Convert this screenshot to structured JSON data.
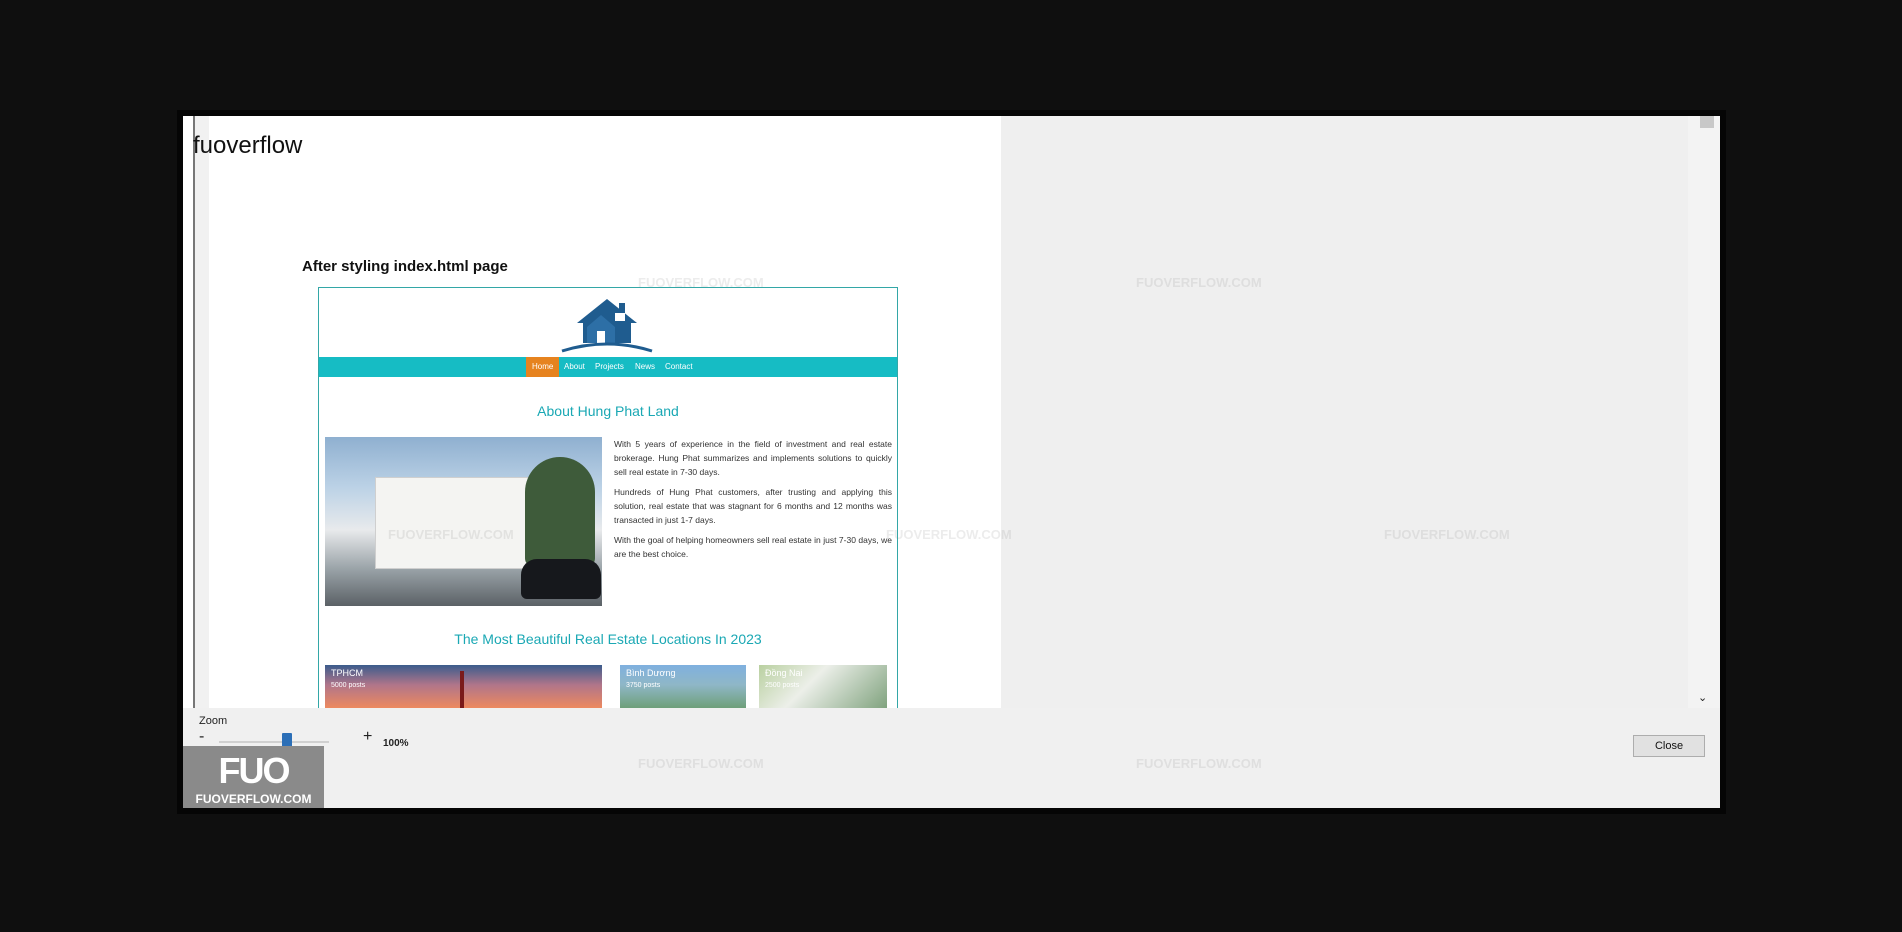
{
  "site_title": "fuoverflow",
  "caption": "After styling index.html page",
  "preview": {
    "nav": [
      "Home",
      "About",
      "Projects",
      "News",
      "Contact"
    ],
    "about_heading": "About Hung Phat Land",
    "paragraphs": [
      "With 5 years of experience in the field of investment and real estate brokerage. Hung Phat summarizes and implements solutions to quickly sell real estate in 7-30 days.",
      "Hundreds of Hung Phat customers, after trusting and applying this solution, real estate that was stagnant for 6 months and 12 months was transacted in just 1-7 days.",
      "With the goal of helping homeowners sell real estate in just 7-30 days, we are the best choice."
    ],
    "locations_heading": "The Most Beautiful Real Estate Locations In 2023",
    "cards": [
      {
        "name": "TPHCM",
        "posts": "5000 posts"
      },
      {
        "name": "Bình Dương",
        "posts": "3750 posts"
      },
      {
        "name": "Đồng Nai",
        "posts": "2500 posts"
      }
    ]
  },
  "watermark_text": "FUOVERFLOW.COM",
  "zoom": {
    "label": "Zoom",
    "minus": "-",
    "plus": "+",
    "value": "100%"
  },
  "close_label": "Close",
  "brand": {
    "logo": "FUO",
    "text": "FUOVERFLOW.COM"
  },
  "colors": {
    "nav": "#16bcc4",
    "nav_active": "#e6831f",
    "heading": "#1aa8b4",
    "slider": "#2c6fb7"
  }
}
